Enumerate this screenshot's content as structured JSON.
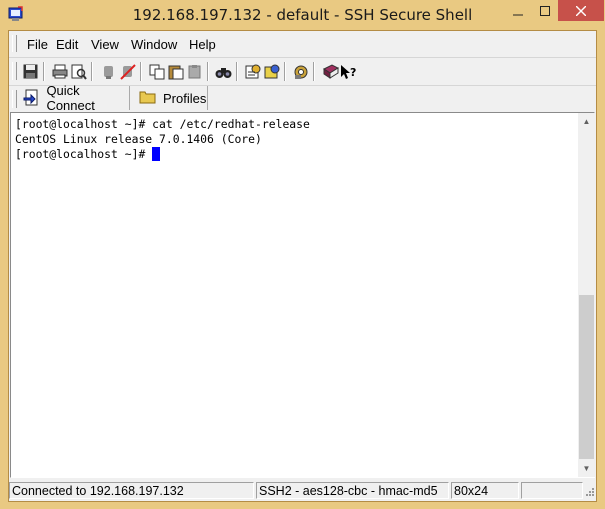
{
  "window": {
    "title": "192.168.197.132 - default - SSH Secure Shell",
    "app_icon": "ssh-terminal-icon",
    "controls": {
      "minimize": "minimize-icon",
      "maximize": "maximize-icon",
      "close": "close-icon"
    }
  },
  "menu": {
    "items": [
      {
        "label": "File"
      },
      {
        "label": "Edit"
      },
      {
        "label": "View"
      },
      {
        "label": "Window"
      },
      {
        "label": "Help"
      }
    ]
  },
  "toolbar": {
    "icons": [
      "save-icon",
      "print-icon",
      "print-preview-icon",
      "connect-icon",
      "disconnect-icon",
      "copy-icon",
      "paste-icon",
      "paste-disabled-icon",
      "find-icon",
      "settings-icon",
      "profile-settings-icon",
      "file-transfer-icon",
      "help-book-icon",
      "context-help-icon"
    ]
  },
  "quickbar": {
    "quick_connect": "Quick Connect",
    "profiles": "Profiles"
  },
  "terminal": {
    "lines": [
      "[root@localhost ~]# cat /etc/redhat-release",
      "CentOS Linux release 7.0.1406 (Core)",
      "[root@localhost ~]# "
    ]
  },
  "status": {
    "connection": "Connected to 192.168.197.132",
    "cipher": "SSH2 - aes128-cbc - hmac-md5",
    "size": "80x24",
    "extra": ""
  },
  "colors": {
    "titlebar": "#e9c982",
    "close": "#c7514a",
    "cursor": "#0000ff"
  }
}
